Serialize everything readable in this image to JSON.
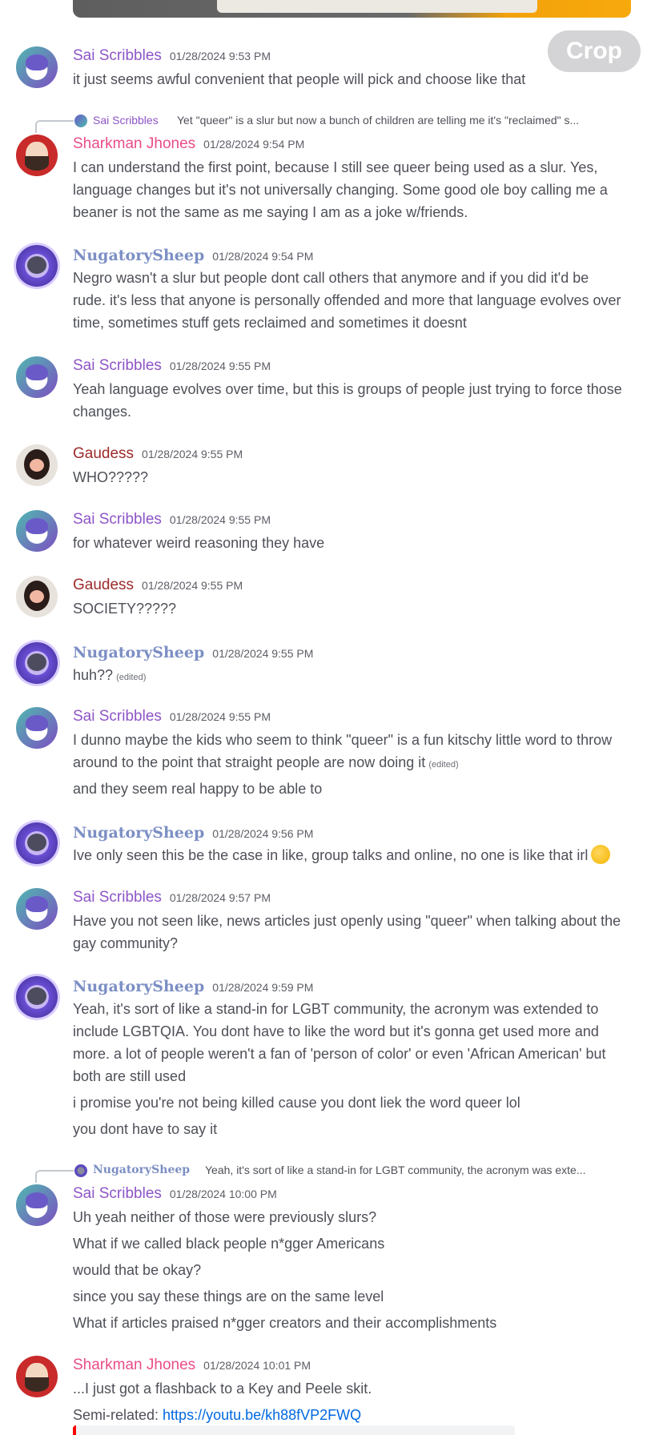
{
  "crop_label": "Crop",
  "messages": [
    {
      "author": "Sai Scribbles",
      "time": "01/28/2024 9:53 PM",
      "lines": [
        "it just seems awful convenient that people will pick and choose like that"
      ]
    },
    {
      "reply": {
        "author": "Sai Scribbles",
        "text": "Yet \"queer\" is a slur but now a bunch of children are telling me it's \"reclaimed\" s..."
      },
      "author": "Sharkman Jhones",
      "time": "01/28/2024 9:54 PM",
      "lines": [
        "I can understand the first point, because I still see queer being used as a slur. Yes,",
        "language changes but it's not universally changing. Some good ole boy calling me a",
        "beaner is not the same as me saying I am as a joke w/friends."
      ]
    },
    {
      "author": "NugatorySheep",
      "time": "01/28/2024 9:54 PM",
      "lines": [
        "Negro wasn't a slur but people dont call others that anymore and if you did it'd be",
        "rude. it's less that anyone is personally offended and more that language evolves over",
        "time, sometimes stuff gets reclaimed and sometimes it doesnt"
      ]
    },
    {
      "author": "Sai Scribbles",
      "time": "01/28/2024 9:55 PM",
      "lines": [
        "Yeah language evolves over time, but this is groups of people just trying to force those",
        "changes."
      ]
    },
    {
      "author": "Gaudess",
      "time": "01/28/2024 9:55 PM",
      "lines": [
        "WHO?????"
      ]
    },
    {
      "author": "Sai Scribbles",
      "time": "01/28/2024 9:55 PM",
      "lines": [
        "for whatever weird reasoning they have"
      ]
    },
    {
      "author": "Gaudess",
      "time": "01/28/2024 9:55 PM",
      "lines": [
        "SOCIETY?????"
      ]
    },
    {
      "author": "NugatorySheep",
      "time": "01/28/2024 9:55 PM",
      "lines": [
        "huh??"
      ],
      "edited": "(edited)"
    },
    {
      "author": "Sai Scribbles",
      "time": "01/28/2024 9:55 PM",
      "lines": [
        "I dunno maybe the kids who seem to think \"queer\" is a fun kitschy little word to throw",
        "around to the point that straight people are now doing it",
        "and they seem real happy to be able to"
      ],
      "edited": "(edited)"
    },
    {
      "author": "NugatorySheep",
      "time": "01/28/2024 9:56 PM",
      "lines": [
        "Ive only seen this be the case in like, group talks and online, no one is like that irl"
      ],
      "emoji": "grimacing-face-emoji"
    },
    {
      "author": "Sai Scribbles",
      "time": "01/28/2024 9:57 PM",
      "lines": [
        "Have you not seen like, news articles just openly using \"queer\" when talking about the",
        "gay community?"
      ]
    },
    {
      "author": "NugatorySheep",
      "time": "01/28/2024 9:59 PM",
      "lines": [
        "Yeah, it's sort of like a stand-in for LGBT community, the acronym was extended to",
        "include LGBTQIA. You dont have to like the word but it's gonna get used more and",
        "more. a lot of people weren't a fan of 'person of color' or even 'African American' but",
        "both are still used",
        "i promise you're not being killed cause you dont liek the word queer lol",
        "you dont have to say it"
      ]
    },
    {
      "reply": {
        "author": "NugatorySheep",
        "text": "Yeah, it's sort of like a stand-in for LGBT community, the acronym was exte..."
      },
      "author": "Sai Scribbles",
      "time": "01/28/2024 10:00 PM",
      "lines": [
        "Uh yeah neither of those were previously slurs?",
        "What if we called black people n*gger Americans",
        "would that be okay?",
        "since you say these things are on the same level",
        "What if articles praised n*gger creators and their accomplishments"
      ]
    },
    {
      "author": "Sharkman Jhones",
      "time": "01/28/2024 10:01 PM",
      "lines": [
        "...I just got a flashback to a Key and Peele skit.",
        "Semi-related: "
      ],
      "link": "https://youtu.be/kh88fVP2FWQ"
    }
  ]
}
